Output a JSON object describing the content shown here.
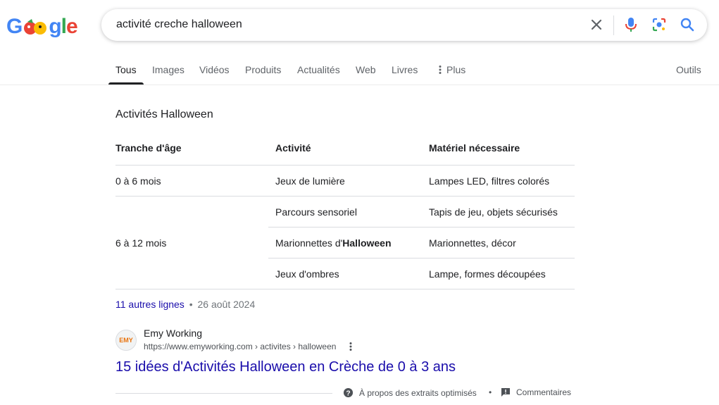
{
  "logo": {
    "text": "Google"
  },
  "search": {
    "query": "activité creche halloween"
  },
  "tabs": [
    {
      "label": "Tous"
    },
    {
      "label": "Images"
    },
    {
      "label": "Vidéos"
    },
    {
      "label": "Produits"
    },
    {
      "label": "Actualités"
    },
    {
      "label": "Web"
    },
    {
      "label": "Livres"
    },
    {
      "label": "Plus"
    }
  ],
  "tools_label": "Outils",
  "snippet": {
    "title": "Activités Halloween",
    "headers": [
      "Tranche d'âge",
      "Activité",
      "Matériel nécessaire"
    ],
    "rows": [
      {
        "age": "0 à 6 mois",
        "activity": "Jeux de lumière",
        "material": "Lampes LED, filtres colorés"
      },
      {
        "age": "6 à 12 mois",
        "activity": "Parcours sensoriel",
        "material": "Tapis de jeu, objets sécurisés"
      },
      {
        "activity_prefix": "Marionnettes d'",
        "activity_bold": "Halloween",
        "material": "Marionnettes, décor"
      },
      {
        "activity": "Jeux d'ombres",
        "material": "Lampe, formes découpées"
      }
    ],
    "more_rows_link": "11 autres lignes",
    "separator": "•",
    "date": "26 août 2024"
  },
  "result": {
    "favicon_text": "EMY",
    "site_name": "Emy Working",
    "url": "https://www.emyworking.com › activites › halloween",
    "title": "15 idées d'Activités Halloween en Crèche de 0 à 3 ans"
  },
  "footer": {
    "about_label": "À propos des extraits optimisés",
    "separator": "•",
    "feedback_label": "Commentaires"
  },
  "colors": {
    "link": "#1a0dab",
    "text": "#202124",
    "secondary": "#5f6368"
  }
}
